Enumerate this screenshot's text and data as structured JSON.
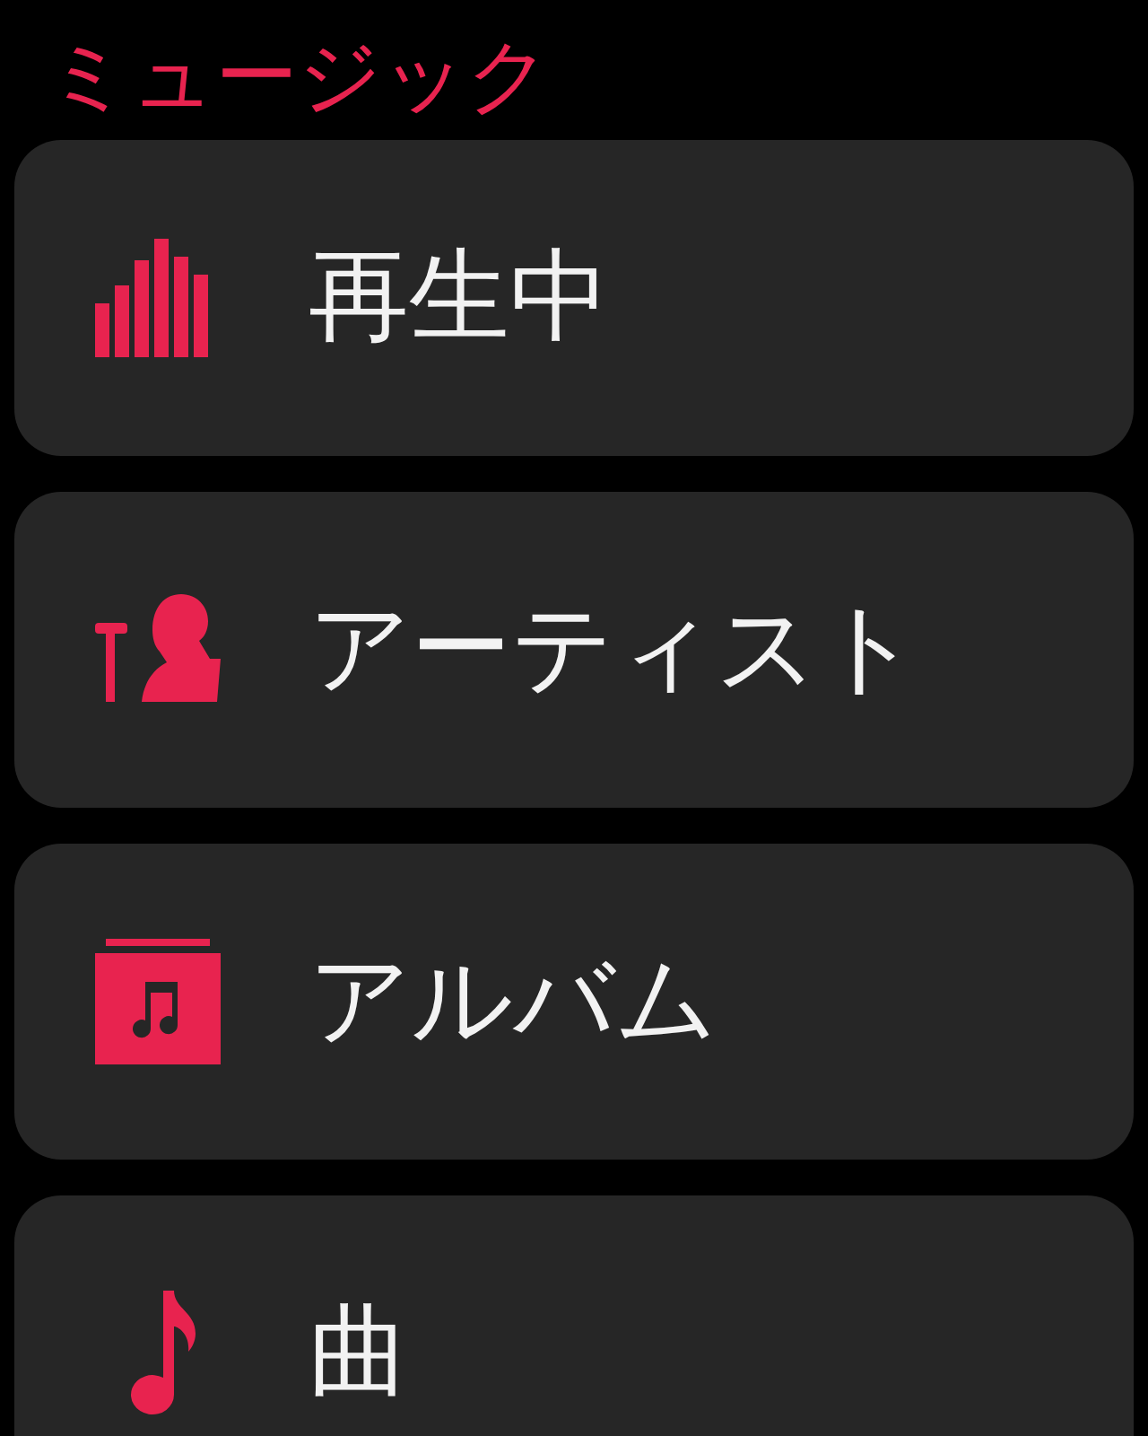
{
  "title": "ミュージック",
  "items": [
    {
      "kind": "now-playing",
      "label": "再生中"
    },
    {
      "kind": "artists",
      "label": "アーティスト"
    },
    {
      "kind": "albums",
      "label": "アルバム"
    },
    {
      "kind": "songs",
      "label": "曲"
    }
  ]
}
